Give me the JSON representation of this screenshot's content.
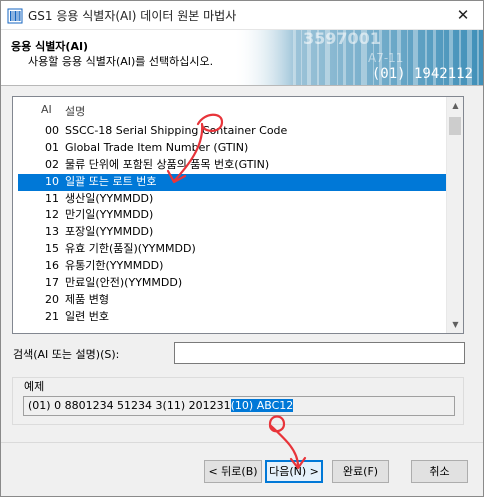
{
  "window": {
    "title": "GS1 응용 식별자(AI) 데이터 원본 마법사",
    "close_glyph": "✕"
  },
  "banner": {
    "heading": "응용 식별자(AI)",
    "description": "사용할 응용 식별자(AI)를 선택하십시오.",
    "code": "(01) 1942112",
    "bg_digits_1": "3597001",
    "bg_digits_2": "A7-11"
  },
  "list": {
    "header_ai": "AI",
    "header_desc": "설명",
    "rows": [
      {
        "code": "00",
        "desc": "SSCC-18 Serial Shipping Container Code"
      },
      {
        "code": "01",
        "desc": "Global Trade Item Number (GTIN)"
      },
      {
        "code": "02",
        "desc": "물류 단위에 포함된 상품의 품목 번호(GTIN)"
      },
      {
        "code": "10",
        "desc": "일괄 또는 로트 번호"
      },
      {
        "code": "11",
        "desc": "생산일(YYMMDD)"
      },
      {
        "code": "12",
        "desc": "만기일(YYMMDD)"
      },
      {
        "code": "13",
        "desc": "포장일(YYMMDD)"
      },
      {
        "code": "15",
        "desc": "유효 기한(품질)(YYMMDD)"
      },
      {
        "code": "16",
        "desc": "유통기한(YYMMDD)"
      },
      {
        "code": "17",
        "desc": "만료일(안전)(YYMMDD)"
      },
      {
        "code": "20",
        "desc": "제품 변형"
      },
      {
        "code": "21",
        "desc": "일련 번호"
      }
    ],
    "selected_index": 3
  },
  "search": {
    "label": "검색(AI 또는 설명)(S):",
    "value": ""
  },
  "example": {
    "label": "예제",
    "text_plain": "(01) 0 8801234 51234 3(11) 201231",
    "text_highlight": "(10) ABC12"
  },
  "buttons": {
    "back": "< 뒤로(B)",
    "next": "다음(N) >",
    "finish": "완료(F)",
    "cancel": "취소"
  },
  "colors": {
    "accent": "#0078d7",
    "annotation": "#e8343a"
  }
}
